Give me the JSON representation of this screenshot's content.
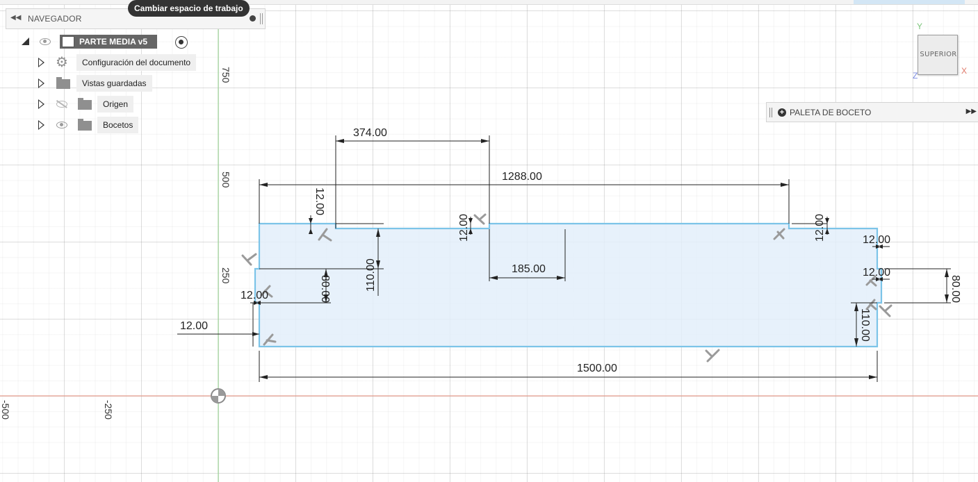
{
  "navigator": {
    "collapse_glyph": "◀◀",
    "title": "NAVEGADOR",
    "tooltip": "Cambiar espacio de trabajo",
    "root": {
      "label": "PARTE MEDIA v5"
    },
    "items": [
      {
        "label": "Configuración del documento",
        "icon": "gear-icon"
      },
      {
        "label": "Vistas guardadas",
        "icon": "folder-icon"
      },
      {
        "label": "Origen",
        "icon": "folder-icon",
        "visibility": "hidden"
      },
      {
        "label": "Bocetos",
        "icon": "folder-icon",
        "visibility": "visible"
      }
    ]
  },
  "viewcube": {
    "face": "SUPERIOR",
    "axis_y": "Y",
    "axis_x": "X",
    "axis_z": "Z"
  },
  "palette": {
    "title": "PALETA DE BOCETO",
    "plus_glyph": "+",
    "expand_glyph": "▶▶"
  },
  "axes": {
    "v_ticks": [
      "750",
      "500",
      "250"
    ],
    "h_ticks": [
      "-500",
      "-250"
    ]
  },
  "dimensions": {
    "d374": "374.00",
    "d1288": "1288.00",
    "d185": "185.00",
    "d1500": "1500.00",
    "d12_topleft": "12.00",
    "d12_topmid": "12.00",
    "d12_topright": "12.00",
    "d12_right_a": "12.00",
    "d12_right_b": "12.00",
    "d12_left_a": "12.00",
    "d12_left_b": "12.00",
    "d110_left": "110.00",
    "d110_right": "110.00",
    "d80_left": "80.00",
    "d80_right": "80.00"
  },
  "colors": {
    "sketch_line": "#7cc4e8",
    "sketch_fill": "#e3effa",
    "x_axis": "#e8a090",
    "y_axis": "#a6d9a0",
    "dimension": "#222222"
  }
}
